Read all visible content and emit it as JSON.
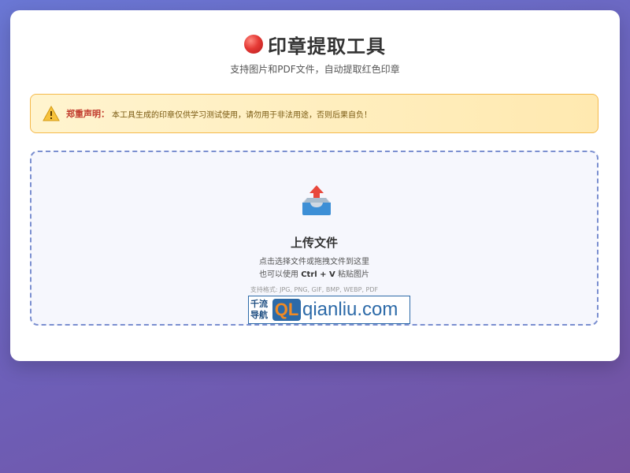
{
  "header": {
    "title": "印章提取工具",
    "subtitle": "支持图片和PDF文件，自动提取红色印章",
    "title_icon": "red-circle-icon"
  },
  "warning": {
    "icon": "warning-icon",
    "label": "郑重声明：",
    "text": "本工具生成的印章仅供学习测试使用，请勿用于非法用途，否则后果自负！"
  },
  "upload": {
    "icon": "upload-tray-icon",
    "title": "上传文件",
    "hint_line1": "点击选择文件或拖拽文件到这里",
    "hint_line2_prefix": "也可以使用 ",
    "hint_line2_keys": "Ctrl + V",
    "hint_line2_suffix": " 粘贴图片",
    "formats": "支持格式: JPG, PNG, GIF, BMP, WEBP, PDF"
  },
  "watermark": {
    "cn_line1": "千流",
    "cn_line2": "导航",
    "logo": "QL",
    "domain": "qianliu.com"
  },
  "colors": {
    "accent_red": "#e53935",
    "warning_border": "#f5b94a",
    "dropzone_border": "#7b8fd0",
    "brand_blue": "#2c6aa8",
    "brand_orange": "#f08a24"
  }
}
